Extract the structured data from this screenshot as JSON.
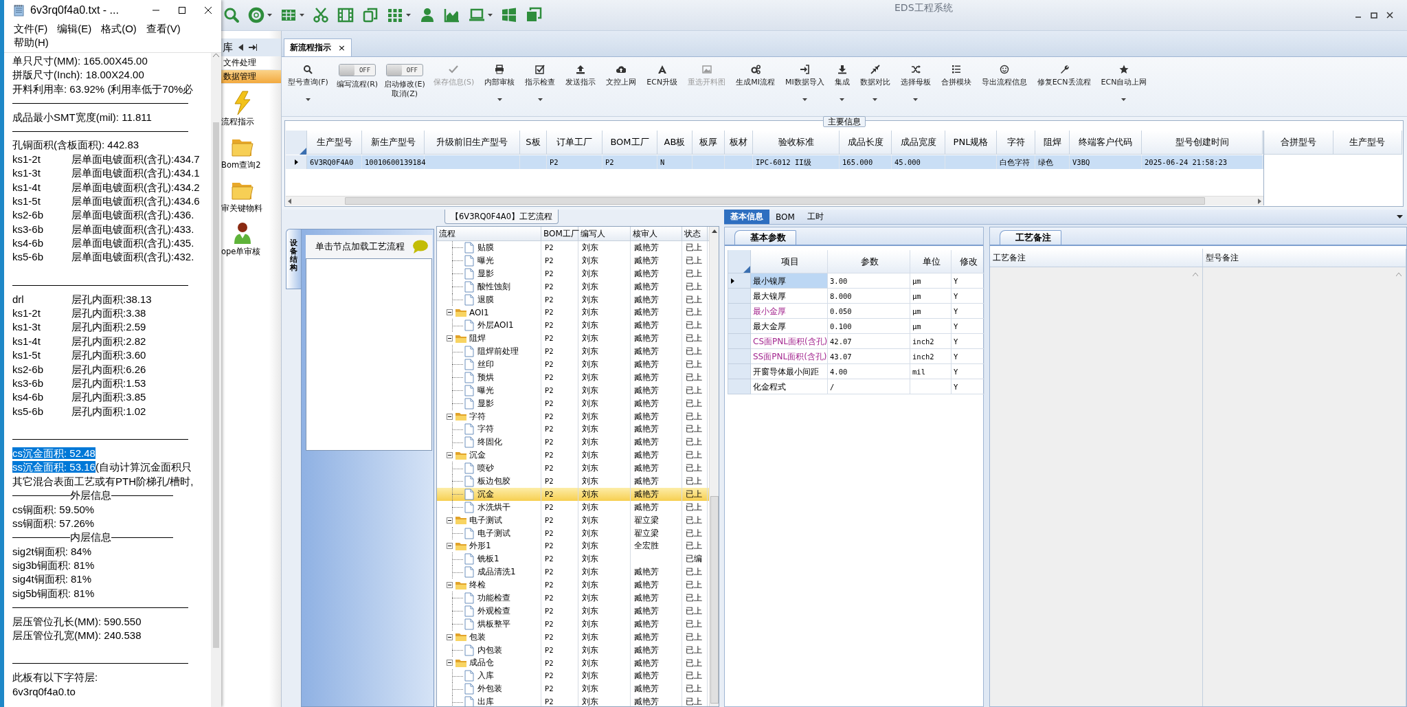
{
  "notepad": {
    "title": "6v3rq0f4a0.txt - ...",
    "menu": [
      "文件(F)",
      "编辑(E)",
      "格式(O)",
      "查看(V)",
      "帮助(H)"
    ],
    "lines": [
      {
        "kind": "text",
        "text": "单只尺寸(MM): 165.00X45.00",
        "selected": false
      },
      {
        "kind": "text",
        "text": "拼版尺寸(Inch): 18.00X24.00",
        "selected": false
      },
      {
        "kind": "text",
        "text": "开料利用率: 63.92% (利用率低于70%必",
        "selected": false
      },
      {
        "kind": "rule"
      },
      {
        "kind": "text",
        "text": "成品最小SMT宽度(mil): 11.811",
        "selected": false
      },
      {
        "kind": "rule"
      },
      {
        "kind": "text",
        "text": "孔铜面积(含板面积): 442.83",
        "selected": false
      },
      {
        "kind": "pair",
        "key": "ks1-2t",
        "value": "层单面电镀面积(含孔):434.7"
      },
      {
        "kind": "pair",
        "key": "ks1-3t",
        "value": "层单面电镀面积(含孔):434.1"
      },
      {
        "kind": "pair",
        "key": "ks1-4t",
        "value": "层单面电镀面积(含孔):434.2"
      },
      {
        "kind": "pair",
        "key": "ks1-5t",
        "value": "层单面电镀面积(含孔):434.6"
      },
      {
        "kind": "pair",
        "key": "ks2-6b",
        "value": "层单面电镀面积(含孔):436."
      },
      {
        "kind": "pair",
        "key": "ks3-6b",
        "value": "层单面电镀面积(含孔):433."
      },
      {
        "kind": "pair",
        "key": "ks4-6b",
        "value": "层单面电镀面积(含孔):435."
      },
      {
        "kind": "pair",
        "key": "ks5-6b",
        "value": "层单面电镀面积(含孔):432."
      },
      {
        "kind": "blank"
      },
      {
        "kind": "rule"
      },
      {
        "kind": "pair",
        "key": "drl",
        "value": "层孔内面积:38.13"
      },
      {
        "kind": "pair",
        "key": "ks1-2t",
        "value": "层孔内面积:3.38"
      },
      {
        "kind": "pair",
        "key": "ks1-3t",
        "value": "层孔内面积:2.59"
      },
      {
        "kind": "pair",
        "key": "ks1-4t",
        "value": "层孔内面积:2.82"
      },
      {
        "kind": "pair",
        "key": "ks1-5t",
        "value": "层孔内面积:3.60"
      },
      {
        "kind": "pair",
        "key": "ks2-6b",
        "value": "层孔内面积:6.26"
      },
      {
        "kind": "pair",
        "key": "ks3-6b",
        "value": "层孔内面积:1.53"
      },
      {
        "kind": "pair",
        "key": "ks4-6b",
        "value": "层孔内面积:3.85"
      },
      {
        "kind": "pair",
        "key": "ks5-6b",
        "value": "层孔内面积:1.02"
      },
      {
        "kind": "blank"
      },
      {
        "kind": "rule"
      },
      {
        "kind": "text",
        "text": "cs沉金面积: 52.48",
        "selected": true
      },
      {
        "kind": "text",
        "text": "ss沉金面积: 53.16",
        "selected": true,
        "tail": "(自动计算沉金面积只"
      },
      {
        "kind": "text",
        "text": "其它混合表面工艺或有PTH阶梯孔/槽时,",
        "selected": false
      },
      {
        "kind": "heading",
        "text": "外层信息"
      },
      {
        "kind": "text",
        "text": "cs铜面积: 59.50%",
        "selected": false
      },
      {
        "kind": "text",
        "text": "ss铜面积: 57.26%",
        "selected": false
      },
      {
        "kind": "heading",
        "text": "内层信息"
      },
      {
        "kind": "text",
        "text": "sig2t铜面积: 84%",
        "selected": false
      },
      {
        "kind": "text",
        "text": "sig3b铜面积: 81%",
        "selected": false
      },
      {
        "kind": "text",
        "text": "sig4t铜面积: 81%",
        "selected": false
      },
      {
        "kind": "text",
        "text": "sig5b铜面积: 81%",
        "selected": false
      },
      {
        "kind": "rule"
      },
      {
        "kind": "text",
        "text": "层压管位孔长(MM): 590.550",
        "selected": false
      },
      {
        "kind": "text",
        "text": "层压管位孔宽(MM): 240.538",
        "selected": false
      },
      {
        "kind": "blank"
      },
      {
        "kind": "rule"
      },
      {
        "kind": "text",
        "text": "此板有以下字符层:",
        "selected": false
      },
      {
        "kind": "text",
        "text": "6v3rq0f4a0.to",
        "selected": false
      }
    ]
  },
  "app": {
    "title": "EDS工程系统"
  },
  "nav": {
    "header": "库",
    "items": [
      {
        "label": "文件处理",
        "selected": false
      },
      {
        "label": "数据管理",
        "selected": true
      }
    ],
    "shortcuts": [
      "流程指示",
      "Bom查询2",
      "审关键物料",
      "ope单审核"
    ]
  },
  "doc_tab": {
    "label": "新流程指示",
    "close": "×"
  },
  "ribbon": [
    {
      "kind": "button",
      "label": "型号查询(F)",
      "disabled": false,
      "dropdown": true
    },
    {
      "kind": "toggle",
      "state_label": "OFF",
      "on": false,
      "label": "编写流程(R)"
    },
    {
      "kind": "toggle",
      "state_label": "OFF",
      "on": false,
      "label": "启动修改(E)\n取消(Z)"
    },
    {
      "kind": "button",
      "label": "保存信息(S)",
      "disabled": true,
      "dropdown": false
    },
    {
      "kind": "button",
      "label": "内部审核",
      "disabled": false,
      "dropdown": true
    },
    {
      "kind": "button",
      "label": "指示检查",
      "disabled": false,
      "dropdown": true
    },
    {
      "kind": "button",
      "label": "发送指示",
      "disabled": false,
      "dropdown": false
    },
    {
      "kind": "button",
      "label": "文控上网",
      "disabled": false,
      "dropdown": false
    },
    {
      "kind": "button",
      "label": "ECN升级",
      "disabled": false,
      "dropdown": false
    },
    {
      "kind": "button",
      "label": "重选开料图",
      "disabled": true,
      "dropdown": false
    },
    {
      "kind": "button",
      "label": "生成MI流程",
      "disabled": false,
      "dropdown": false
    },
    {
      "kind": "button",
      "label": "MI数据导入",
      "disabled": false,
      "dropdown": true
    },
    {
      "kind": "button",
      "label": "集成",
      "disabled": false,
      "dropdown": true
    },
    {
      "kind": "button",
      "label": "数据对比",
      "disabled": false,
      "dropdown": true
    },
    {
      "kind": "button",
      "label": "选择母板",
      "disabled": false,
      "dropdown": true
    },
    {
      "kind": "button",
      "label": "合拼模块",
      "disabled": false,
      "dropdown": false
    },
    {
      "kind": "button",
      "label": "导出流程信息",
      "disabled": false,
      "dropdown": false
    },
    {
      "kind": "button",
      "label": "修复ECN丢流程",
      "disabled": false,
      "dropdown": false
    },
    {
      "kind": "button",
      "label": "ECN自动上网",
      "disabled": false,
      "dropdown": true
    }
  ],
  "main_info": {
    "title": "主要信息",
    "columns": [
      "生产型号",
      "新生产型号",
      "升级前旧生产型号",
      "S板",
      "订单工厂",
      "BOM工厂",
      "AB板",
      "板厚",
      "板材",
      "验收标准",
      "成品长度",
      "成品宽度",
      "PNL规格",
      "字符",
      "阻焊",
      "终端客户代码",
      "型号创建时间"
    ],
    "rows": [
      {
        "selected": true,
        "cells": [
          "6V3RQ0F4A0",
          "10010600139184",
          null,
          null,
          "P2",
          "P2",
          "N",
          null,
          null,
          "IPC-6012 II级",
          "165.000",
          "45.000",
          null,
          "白色字符",
          "绿色",
          "V3BQ",
          "2025-06-24 21:58:23"
        ]
      }
    ],
    "merge_columns": [
      "合拼型号",
      "生产型号"
    ]
  },
  "process_panel": {
    "tab": "设备结构",
    "hint": "单击节点加载工艺流程"
  },
  "flow": {
    "title": "【6V3RQ0F4A0】工艺流程",
    "columns": [
      "流程",
      "BOM工厂",
      "编写人",
      "核审人",
      "状态"
    ],
    "items": [
      {
        "kind": "continued",
        "children": [
          {
            "name": "贴膜",
            "bom": "P2",
            "writer": "刘东",
            "reviewer": "臧艳芳",
            "status": "已上",
            "selected": false
          },
          {
            "name": "曝光",
            "bom": "P2",
            "writer": "刘东",
            "reviewer": "臧艳芳",
            "status": "已上",
            "selected": false
          },
          {
            "name": "显影",
            "bom": "P2",
            "writer": "刘东",
            "reviewer": "臧艳芳",
            "status": "已上",
            "selected": false
          },
          {
            "name": "酸性蚀刻",
            "bom": "P2",
            "writer": "刘东",
            "reviewer": "臧艳芳",
            "status": "已上",
            "selected": false
          },
          {
            "name": "退膜",
            "bom": "P2",
            "writer": "刘东",
            "reviewer": "臧艳芳",
            "status": "已上",
            "selected": false
          }
        ]
      },
      {
        "kind": "group",
        "name": "AOI1",
        "bom": "P2",
        "writer": "刘东",
        "reviewer": "臧艳芳",
        "status": "已上",
        "selected": false,
        "expanded": true,
        "children": [
          {
            "name": "外层AOI1",
            "bom": "P2",
            "writer": "刘东",
            "reviewer": "臧艳芳",
            "status": "已上",
            "selected": false
          }
        ]
      },
      {
        "kind": "group",
        "name": "阻焊",
        "bom": "P2",
        "writer": "刘东",
        "reviewer": "臧艳芳",
        "status": "已上",
        "selected": false,
        "expanded": true,
        "children": [
          {
            "name": "阻焊前处理",
            "bom": "P2",
            "writer": "刘东",
            "reviewer": "臧艳芳",
            "status": "已上",
            "selected": false
          },
          {
            "name": "丝印",
            "bom": "P2",
            "writer": "刘东",
            "reviewer": "臧艳芳",
            "status": "已上",
            "selected": false
          },
          {
            "name": "预烘",
            "bom": "P2",
            "writer": "刘东",
            "reviewer": "臧艳芳",
            "status": "已上",
            "selected": false
          },
          {
            "name": "曝光",
            "bom": "P2",
            "writer": "刘东",
            "reviewer": "臧艳芳",
            "status": "已上",
            "selected": false
          },
          {
            "name": "显影",
            "bom": "P2",
            "writer": "刘东",
            "reviewer": "臧艳芳",
            "status": "已上",
            "selected": false
          }
        ]
      },
      {
        "kind": "group",
        "name": "字符",
        "bom": "P2",
        "writer": "刘东",
        "reviewer": "臧艳芳",
        "status": "已上",
        "selected": false,
        "expanded": true,
        "children": [
          {
            "name": "字符",
            "bom": "P2",
            "writer": "刘东",
            "reviewer": "臧艳芳",
            "status": "已上",
            "selected": false
          },
          {
            "name": "终固化",
            "bom": "P2",
            "writer": "刘东",
            "reviewer": "臧艳芳",
            "status": "已上",
            "selected": false
          }
        ]
      },
      {
        "kind": "group",
        "name": "沉金",
        "bom": "P2",
        "writer": "刘东",
        "reviewer": "臧艳芳",
        "status": "已上",
        "selected": false,
        "expanded": true,
        "children": [
          {
            "name": "喷砂",
            "bom": "P2",
            "writer": "刘东",
            "reviewer": "臧艳芳",
            "status": "已上",
            "selected": false
          },
          {
            "name": "板边包胶",
            "bom": "P2",
            "writer": "刘东",
            "reviewer": "臧艳芳",
            "status": "已上",
            "selected": false
          },
          {
            "name": "沉金",
            "bom": "P2",
            "writer": "刘东",
            "reviewer": "臧艳芳",
            "status": "已上",
            "selected": true
          },
          {
            "name": "水洗烘干",
            "bom": "P2",
            "writer": "刘东",
            "reviewer": "臧艳芳",
            "status": "已上",
            "selected": false
          }
        ]
      },
      {
        "kind": "group",
        "name": "电子测试",
        "bom": "P2",
        "writer": "刘东",
        "reviewer": "翟立梁",
        "status": "已上",
        "selected": false,
        "expanded": true,
        "children": [
          {
            "name": "电子测试",
            "bom": "P2",
            "writer": "刘东",
            "reviewer": "翟立梁",
            "status": "已上",
            "selected": false
          }
        ]
      },
      {
        "kind": "group",
        "name": "外形1",
        "bom": "P2",
        "writer": "刘东",
        "reviewer": "全宏胜",
        "status": "已上",
        "selected": false,
        "expanded": true,
        "children": [
          {
            "name": "铣板1",
            "bom": "P2",
            "writer": "刘东",
            "status": "已编",
            "selected": false
          },
          {
            "name": "成品清洗1",
            "bom": "P2",
            "writer": "刘东",
            "reviewer": "臧艳芳",
            "status": "已上",
            "selected": false
          }
        ]
      },
      {
        "kind": "group",
        "name": "终检",
        "bom": "P2",
        "writer": "刘东",
        "reviewer": "臧艳芳",
        "status": "已上",
        "selected": false,
        "expanded": true,
        "children": [
          {
            "name": "功能检查",
            "bom": "P2",
            "writer": "刘东",
            "reviewer": "臧艳芳",
            "status": "已上",
            "selected": false
          },
          {
            "name": "外观检查",
            "bom": "P2",
            "writer": "刘东",
            "reviewer": "臧艳芳",
            "status": "已上",
            "selected": false
          },
          {
            "name": "烘板整平",
            "bom": "P2",
            "writer": "刘东",
            "reviewer": "臧艳芳",
            "status": "已上",
            "selected": false
          }
        ]
      },
      {
        "kind": "group",
        "name": "包装",
        "bom": "P2",
        "writer": "刘东",
        "reviewer": "臧艳芳",
        "status": "已上",
        "selected": false,
        "expanded": true,
        "children": [
          {
            "name": "内包装",
            "bom": "P2",
            "writer": "刘东",
            "reviewer": "臧艳芳",
            "status": "已上",
            "selected": false
          }
        ]
      },
      {
        "kind": "group",
        "name": "成品仓",
        "bom": "P2",
        "writer": "刘东",
        "reviewer": "臧艳芳",
        "status": "已上",
        "selected": false,
        "expanded": true,
        "children": [
          {
            "name": "入库",
            "bom": "P2",
            "writer": "刘东",
            "reviewer": "臧艳芳",
            "status": "已上",
            "selected": false
          },
          {
            "name": "外包装",
            "bom": "P2",
            "writer": "刘东",
            "reviewer": "臧艳芳",
            "status": "已上",
            "selected": false
          },
          {
            "name": "出库",
            "bom": "P2",
            "writer": "刘东",
            "reviewer": "臧艳芳",
            "status": "已上",
            "selected": false
          }
        ]
      }
    ]
  },
  "detail": {
    "tabs": [
      {
        "label": "基本信息",
        "selected": true
      },
      {
        "label": "BOM",
        "selected": false
      },
      {
        "label": "工时",
        "selected": false
      }
    ],
    "params": {
      "tab": "基本参数",
      "columns": [
        "项目",
        "参数",
        "单位",
        "修改"
      ],
      "rows": [
        {
          "item": "最小镍厚",
          "value": "3.00",
          "unit": "μm",
          "modify": "Y",
          "highlighted": false,
          "selected": true
        },
        {
          "item": "最大镍厚",
          "value": "8.000",
          "unit": "μm",
          "modify": "Y",
          "highlighted": false,
          "selected": false
        },
        {
          "item": "最小金厚",
          "value": "0.050",
          "unit": "μm",
          "modify": "Y",
          "highlighted": true,
          "selected": false
        },
        {
          "item": "最大金厚",
          "value": "0.100",
          "unit": "μm",
          "modify": "Y",
          "highlighted": false,
          "selected": false
        },
        {
          "item": "CS面PNL面积(含孔)",
          "value": "42.07",
          "unit": "inch2",
          "modify": "Y",
          "highlighted": true,
          "selected": false
        },
        {
          "item": "SS面PNL面积(含孔)",
          "value": "43.07",
          "unit": "inch2",
          "modify": "Y",
          "highlighted": true,
          "selected": false
        },
        {
          "item": "开窗导体最小间距",
          "value": "4.00",
          "unit": "mil",
          "modify": "Y",
          "highlighted": false,
          "selected": false
        },
        {
          "item": "化金程式",
          "value": "/",
          "modify": "Y",
          "highlighted": false,
          "selected": false
        }
      ]
    },
    "notes": {
      "tab": "工艺备注",
      "columns": [
        "工艺备注",
        "型号备注"
      ]
    }
  }
}
